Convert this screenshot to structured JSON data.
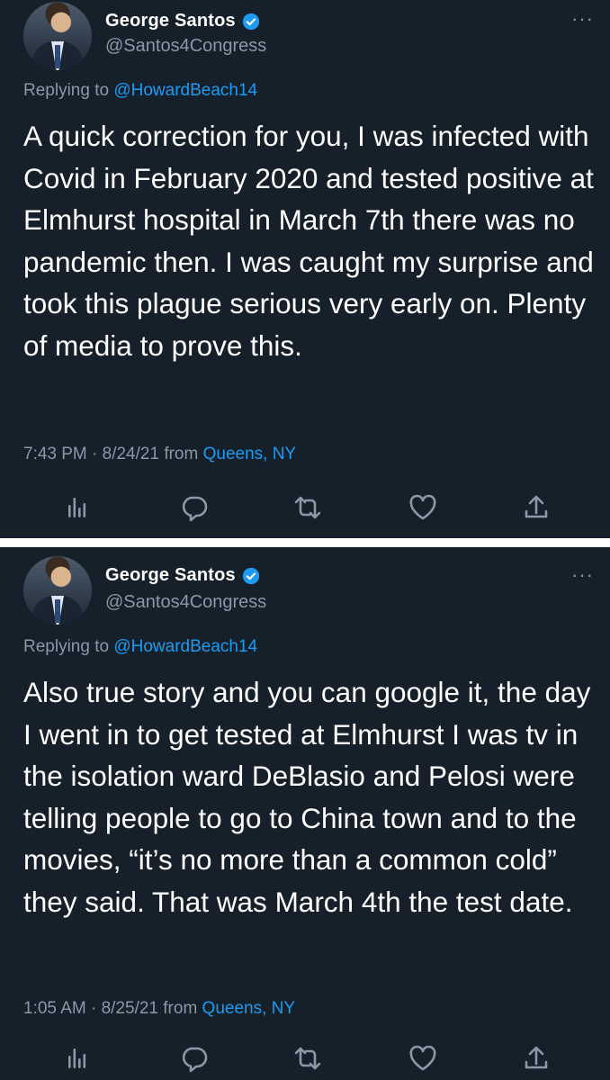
{
  "tweets": [
    {
      "author_name": "George Santos",
      "handle": "@Santos4Congress",
      "more": "···",
      "replying_prefix": "Replying to ",
      "replying_to": "@HowardBeach14",
      "body": "A quick correction for you, I was infected with Covid in February 2020 and tested positive at Elmhurst hospital in March 7th there was no pandemic then. I was caught my surprise and took this plague serious very early on. Plenty of media to prove this.",
      "timestamp": "7:43 PM · 8/24/21 from ",
      "location": "Queens, NY"
    },
    {
      "author_name": "George Santos",
      "handle": "@Santos4Congress",
      "more": "···",
      "replying_prefix": "Replying to ",
      "replying_to": "@HowardBeach14",
      "body": "Also true story and you can google it, the day I went in to get tested at Elmhurst I was tv in the isolation ward DeBlasio and Pelosi were telling people to go to China town and to the movies, “it’s no more than a common cold” they said. That was March 4th the test date.",
      "timestamp": "1:05 AM · 8/25/21 from ",
      "location": "Queens, NY"
    }
  ],
  "action_icons": [
    "analytics-icon",
    "reply-icon",
    "retweet-icon",
    "like-icon",
    "share-icon"
  ],
  "colors": {
    "background": "#15202b",
    "text": "#ffffff",
    "secondary": "#8b98a5",
    "accent": "#1d9bf0",
    "divider": "#ffffff"
  }
}
